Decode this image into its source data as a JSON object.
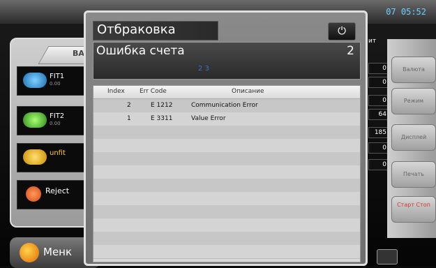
{
  "topbar": {
    "left_text": "",
    "clock": "07 05:52"
  },
  "left_panel": {
    "tab_label": "ВАЛ",
    "items": [
      {
        "label": "FIT1",
        "sub": "0.00"
      },
      {
        "label": "FIT2",
        "sub": "0.00"
      },
      {
        "label": "unfit",
        "sub": ""
      },
      {
        "label": "Reject",
        "sub": ""
      }
    ]
  },
  "bottom": {
    "menu_label": "Менк"
  },
  "counts": {
    "header": "ит",
    "values": [
      "0",
      "0",
      "0",
      "64",
      "185",
      "0",
      "0"
    ]
  },
  "right_panel": {
    "buttons": [
      "Валюта",
      "Режим",
      "Дисплей",
      "Печать",
      "Старт Стоп"
    ]
  },
  "dialog": {
    "title": "Отбраковка",
    "error_title": "Ошибка счета",
    "error_count": "2",
    "error_center": "2 3",
    "table": {
      "headers": [
        "Index",
        "Err Code",
        "Описание"
      ],
      "rows": [
        {
          "index": "2",
          "code": "E 1212",
          "desc": "Communication Error"
        },
        {
          "index": "1",
          "code": "E 3311",
          "desc": "Value Error"
        }
      ]
    }
  },
  "colors": {
    "accent": "#3c6fd0",
    "dialog_border": "#e0e0e0",
    "start_stop": "#dd3333"
  }
}
